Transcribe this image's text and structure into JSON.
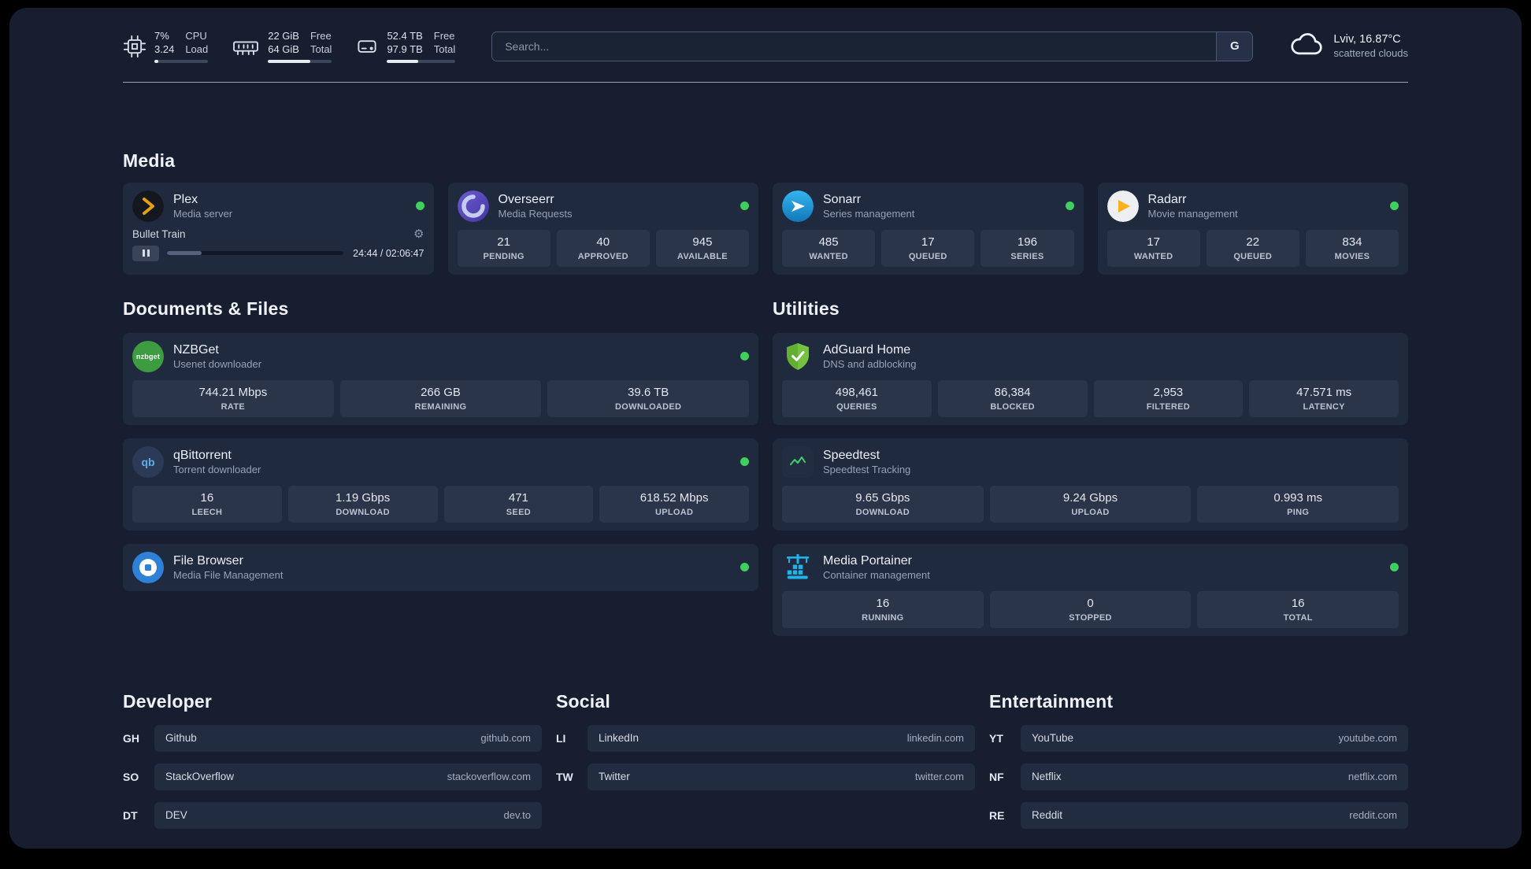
{
  "colors": {
    "status_online": "#3ecf5e",
    "accent_plex": "#e5a00d"
  },
  "icons": {
    "qbittorrent_glyph": "qb",
    "nzbget_glyph": "nzbget",
    "gear_glyph": "⚙"
  },
  "header": {
    "cpu": {
      "value_top": "7%",
      "value_bottom": "3.24",
      "label_top": "CPU",
      "label_bottom": "Load",
      "progress_pct": 7
    },
    "ram": {
      "value_top": "22 GiB",
      "value_bottom": "64 GiB",
      "label_top": "Free",
      "label_bottom": "Total",
      "progress_pct": 66
    },
    "disk": {
      "value_top": "52.4 TB",
      "value_bottom": "97.9 TB",
      "label_top": "Free",
      "label_bottom": "Total",
      "progress_pct": 46
    },
    "search": {
      "placeholder": "Search...",
      "provider_button": "G"
    },
    "weather": {
      "location": "Lviv, 16.87°C",
      "condition": "scattered clouds"
    }
  },
  "sections": {
    "media": {
      "title": "Media",
      "plex": {
        "title": "Plex",
        "subtitle": "Media server",
        "now_playing": "Bullet Train",
        "time": "24:44 / 02:06:47",
        "progress_pct": 19.6
      },
      "overseerr": {
        "title": "Overseerr",
        "subtitle": "Media Requests",
        "stats": [
          {
            "value": "21",
            "label": "PENDING"
          },
          {
            "value": "40",
            "label": "APPROVED"
          },
          {
            "value": "945",
            "label": "AVAILABLE"
          }
        ]
      },
      "sonarr": {
        "title": "Sonarr",
        "subtitle": "Series management",
        "stats": [
          {
            "value": "485",
            "label": "WANTED"
          },
          {
            "value": "17",
            "label": "QUEUED"
          },
          {
            "value": "196",
            "label": "SERIES"
          }
        ]
      },
      "radarr": {
        "title": "Radarr",
        "subtitle": "Movie management",
        "stats": [
          {
            "value": "17",
            "label": "WANTED"
          },
          {
            "value": "22",
            "label": "QUEUED"
          },
          {
            "value": "834",
            "label": "MOVIES"
          }
        ]
      }
    },
    "documents": {
      "title": "Documents & Files",
      "nzbget": {
        "title": "NZBGet",
        "subtitle": "Usenet downloader",
        "stats": [
          {
            "value": "744.21 Mbps",
            "label": "RATE"
          },
          {
            "value": "266 GB",
            "label": "REMAINING"
          },
          {
            "value": "39.6 TB",
            "label": "DOWNLOADED"
          }
        ]
      },
      "qbittorrent": {
        "title": "qBittorrent",
        "subtitle": "Torrent downloader",
        "stats": [
          {
            "value": "16",
            "label": "LEECH"
          },
          {
            "value": "1.19 Gbps",
            "label": "DOWNLOAD"
          },
          {
            "value": "471",
            "label": "SEED"
          },
          {
            "value": "618.52 Mbps",
            "label": "UPLOAD"
          }
        ]
      },
      "filebrowser": {
        "title": "File Browser",
        "subtitle": "Media File Management"
      }
    },
    "utilities": {
      "title": "Utilities",
      "adguard": {
        "title": "AdGuard Home",
        "subtitle": "DNS and adblocking",
        "stats": [
          {
            "value": "498,461",
            "label": "QUERIES"
          },
          {
            "value": "86,384",
            "label": "BLOCKED"
          },
          {
            "value": "2,953",
            "label": "FILTERED"
          },
          {
            "value": "47.571 ms",
            "label": "LATENCY"
          }
        ]
      },
      "speedtest": {
        "title": "Speedtest",
        "subtitle": "Speedtest Tracking",
        "stats": [
          {
            "value": "9.65 Gbps",
            "label": "DOWNLOAD"
          },
          {
            "value": "9.24 Gbps",
            "label": "UPLOAD"
          },
          {
            "value": "0.993 ms",
            "label": "PING"
          }
        ]
      },
      "portainer": {
        "title": "Media Portainer",
        "subtitle": "Container management",
        "stats": [
          {
            "value": "16",
            "label": "RUNNING"
          },
          {
            "value": "0",
            "label": "STOPPED"
          },
          {
            "value": "16",
            "label": "TOTAL"
          }
        ]
      }
    }
  },
  "bookmarks": {
    "developer": {
      "title": "Developer",
      "items": [
        {
          "abbr": "GH",
          "name": "Github",
          "url": "github.com"
        },
        {
          "abbr": "SO",
          "name": "StackOverflow",
          "url": "stackoverflow.com"
        },
        {
          "abbr": "DT",
          "name": "DEV",
          "url": "dev.to"
        }
      ]
    },
    "social": {
      "title": "Social",
      "items": [
        {
          "abbr": "LI",
          "name": "LinkedIn",
          "url": "linkedin.com"
        },
        {
          "abbr": "TW",
          "name": "Twitter",
          "url": "twitter.com"
        }
      ]
    },
    "entertainment": {
      "title": "Entertainment",
      "items": [
        {
          "abbr": "YT",
          "name": "YouTube",
          "url": "youtube.com"
        },
        {
          "abbr": "NF",
          "name": "Netflix",
          "url": "netflix.com"
        },
        {
          "abbr": "RE",
          "name": "Reddit",
          "url": "reddit.com"
        }
      ]
    }
  }
}
